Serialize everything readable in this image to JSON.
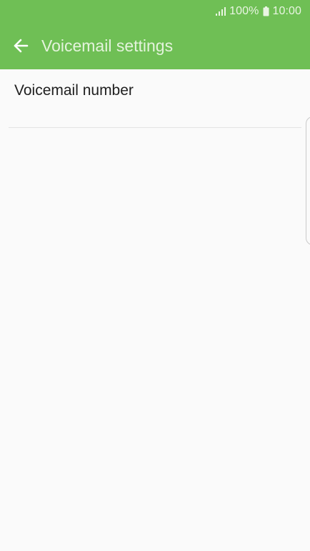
{
  "status_bar": {
    "battery_percent": "100%",
    "time": "10:00",
    "signal_icon": "signal-bars-icon",
    "battery_icon": "battery-icon"
  },
  "app_bar": {
    "back_icon": "arrow-left-icon",
    "title": "Voicemail settings",
    "background_color": "#6fbf55"
  },
  "settings": {
    "items": [
      {
        "label": "Voicemail number"
      }
    ]
  }
}
